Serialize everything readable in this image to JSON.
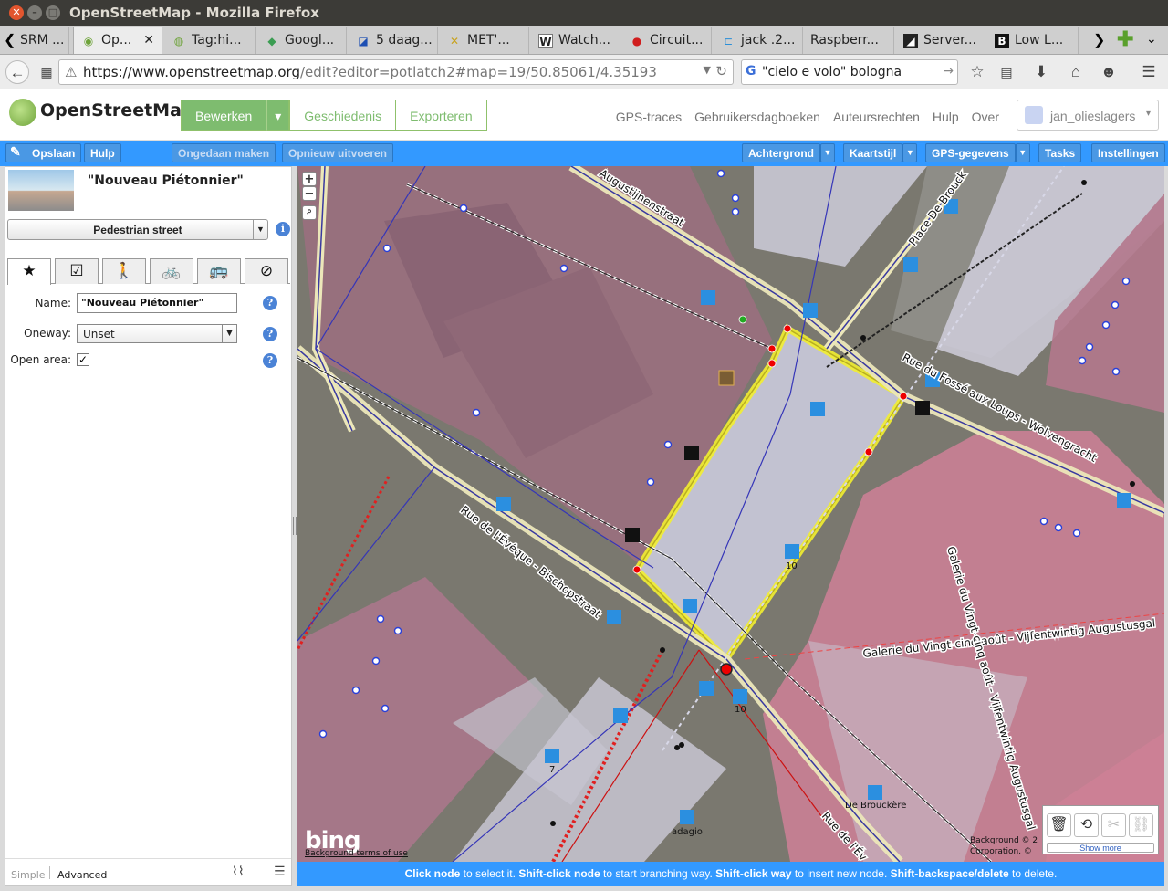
{
  "window": {
    "title": "OpenStreetMap - Mozilla Firefox"
  },
  "tabs": [
    {
      "label": "SRM ...",
      "icon": "scroll-left-icon"
    },
    {
      "label": "Op...",
      "icon": "osm-favicon-icon",
      "active": true
    },
    {
      "label": "Tag:hi...",
      "icon": "osm-wiki-favicon-icon"
    },
    {
      "label": "Googl...",
      "icon": "google-maps-favicon-icon"
    },
    {
      "label": "5 daag...",
      "icon": "news-favicon-icon"
    },
    {
      "label": "MET'...",
      "icon": "tools-favicon-icon"
    },
    {
      "label": "Watch...",
      "icon": "wikipedia-favicon-icon"
    },
    {
      "label": "Circuit...",
      "icon": "pin-favicon-icon"
    },
    {
      "label": "jack .2...",
      "icon": "code-favicon-icon"
    },
    {
      "label": "Raspberr...",
      "icon": ""
    },
    {
      "label": "Server...",
      "icon": "server-favicon-icon"
    },
    {
      "label": "Low L...",
      "icon": "b-favicon-icon"
    }
  ],
  "navbar": {
    "url_host": "https://www.openstreetmap.org",
    "url_path": "/edit?editor=potlatch2#map=19/50.85061/4.35193",
    "search_value": "\"cielo e volo\" bologna"
  },
  "osm": {
    "brand": "OpenStreetMap",
    "edit_label": "Bewerken",
    "history_label": "Geschiedenis",
    "export_label": "Exporteren",
    "links": [
      "GPS-traces",
      "Gebruikersdagboeken",
      "Auteursrechten",
      "Hulp",
      "Over"
    ],
    "username": "jan_olieslagers"
  },
  "toolbar": {
    "save": "Opslaan",
    "help": "Hulp",
    "undo": "Ongedaan maken",
    "redo": "Opnieuw uitvoeren",
    "background": "Achtergrond",
    "mapstyle": "Kaartstijl",
    "gps": "GPS-gegevens",
    "tasks": "Tasks",
    "settings": "Instellingen"
  },
  "sidebar": {
    "feature_title": "\"Nouveau Piétonnier\"",
    "preset": "Pedestrian street",
    "name_label": "Name:",
    "name_value": "\"Nouveau Piétonnier\"",
    "oneway_label": "Oneway:",
    "oneway_value": "Unset",
    "openarea_label": "Open area:",
    "mode_simple": "Simple",
    "mode_advanced": "Advanced"
  },
  "map": {
    "streets": [
      "Augustijnenstraat",
      "Place De Brouck",
      "Rue du Fossé aux Loups - Wolvengracht",
      "Rue de l'Évêque - Bischopstraat",
      "Galerie du Vingt-cinq août - Vijfentwintig Augustusgal",
      "Galerie du Vingt-cinq août - Vijfentwintig Augustusgal",
      "Rue de l'Év"
    ],
    "pois": [
      "10",
      "10",
      "7",
      "adagio",
      "De Brouckère"
    ],
    "bing": "bing",
    "terms": "Background terms of use",
    "attrib_1": "Background © 2",
    "attrib_2": "Corporation, ©"
  },
  "toolpanel": {
    "more": "Show more"
  },
  "status": {
    "p1": "Click node",
    "t1": " to select it. ",
    "p2": "Shift-click node",
    "t2": " to start branching way. ",
    "p3": "Shift-click way",
    "t3": " to insert new node. ",
    "p4": "Shift-backspace/delete",
    "t4": " to delete."
  },
  "colors": {
    "accent": "#3399ff",
    "osm_green": "#7ebc6f",
    "selection": "#f2ee30"
  }
}
